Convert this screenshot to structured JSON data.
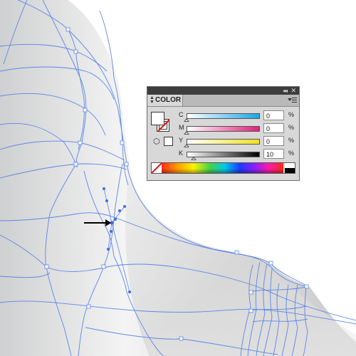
{
  "panel": {
    "title": "COLOR",
    "collapse_glyph": "◂◂",
    "close_glyph": "✕",
    "sliders": [
      {
        "label": "C",
        "value": "0",
        "unit": "%",
        "level": 0,
        "gradient": [
          "#ffffff",
          "#1aa6e8"
        ]
      },
      {
        "label": "M",
        "value": "0",
        "unit": "%",
        "level": 0,
        "gradient": [
          "#ffffff",
          "#e0207a"
        ]
      },
      {
        "label": "Y",
        "value": "0",
        "unit": "%",
        "level": 0,
        "gradient": [
          "#ffffff",
          "#f0e020"
        ]
      },
      {
        "label": "K",
        "value": "10",
        "unit": "%",
        "level": 0.1,
        "gradient": [
          "#ffffff",
          "#000000"
        ]
      }
    ]
  },
  "colors": {
    "mesh_line": "#5b86e5",
    "panel_bg": "#d8d8d8",
    "titlebar": "#3d3d3d"
  },
  "icons": {
    "tab_arrows": "up-down-arrows-icon",
    "panel_menu": "panel-menu-icon",
    "annotation": "right-arrow-icon",
    "cube": "cube-icon"
  }
}
